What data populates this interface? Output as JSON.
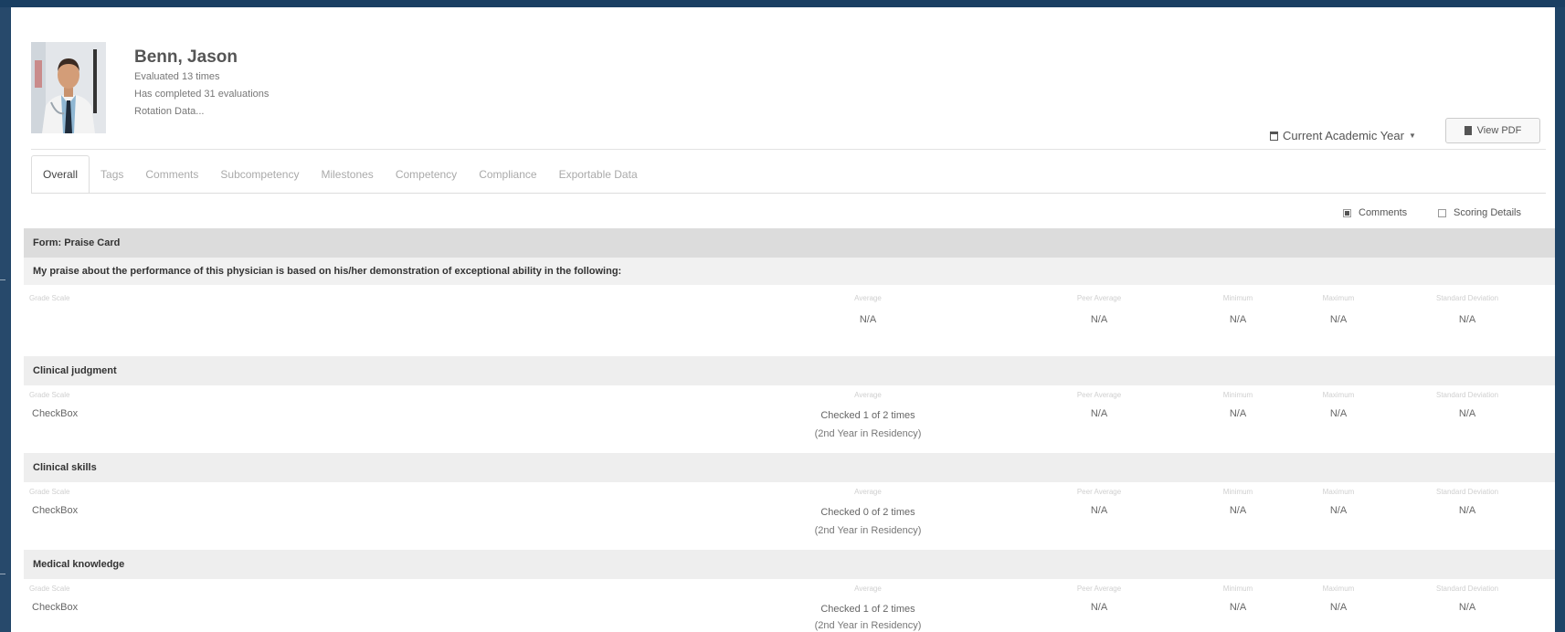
{
  "profile": {
    "name": "Benn, Jason",
    "evaluated": "Evaluated 13 times",
    "completed": "Has completed 31 evaluations",
    "rotation": "Rotation Data..."
  },
  "controls": {
    "academic_year": "Current Academic Year",
    "view_pdf": "View PDF"
  },
  "tabs": [
    "Overall",
    "Tags",
    "Comments",
    "Subcompetency",
    "Milestones",
    "Competency",
    "Compliance",
    "Exportable Data"
  ],
  "options": {
    "comments": {
      "label": "Comments",
      "checked": true
    },
    "scoring_details": {
      "label": "Scoring Details",
      "checked": false
    }
  },
  "form_title": "Form: Praise Card",
  "question": "My praise about the performance of this physician is based on his/her demonstration of exceptional ability in the following:",
  "columns": {
    "grade_scale": "Grade Scale",
    "average": "Average",
    "peer_average": "Peer Average",
    "minimum": "Minimum",
    "maximum": "Maximum",
    "std_dev": "Standard Deviation"
  },
  "summary_row": {
    "average": "N/A",
    "peer_average": "N/A",
    "minimum": "N/A",
    "maximum": "N/A",
    "std_dev": "N/A"
  },
  "sections": [
    {
      "title": "Clinical judgment",
      "scale": "CheckBox",
      "average": "Checked 1 of 2 times",
      "average_note": "(2nd Year in Residency)",
      "peer_average": "N/A",
      "minimum": "N/A",
      "maximum": "N/A",
      "std_dev": "N/A"
    },
    {
      "title": "Clinical skills",
      "scale": "CheckBox",
      "average": "Checked 0 of 2 times",
      "average_note": "(2nd Year in Residency)",
      "peer_average": "N/A",
      "minimum": "N/A",
      "maximum": "N/A",
      "std_dev": "N/A"
    },
    {
      "title": "Medical knowledge",
      "scale": "CheckBox",
      "average": "Checked 1 of 2 times",
      "average_note": "(2nd Year in Residency)",
      "peer_average": "N/A",
      "minimum": "N/A",
      "maximum": "N/A",
      "std_dev": "N/A"
    }
  ]
}
